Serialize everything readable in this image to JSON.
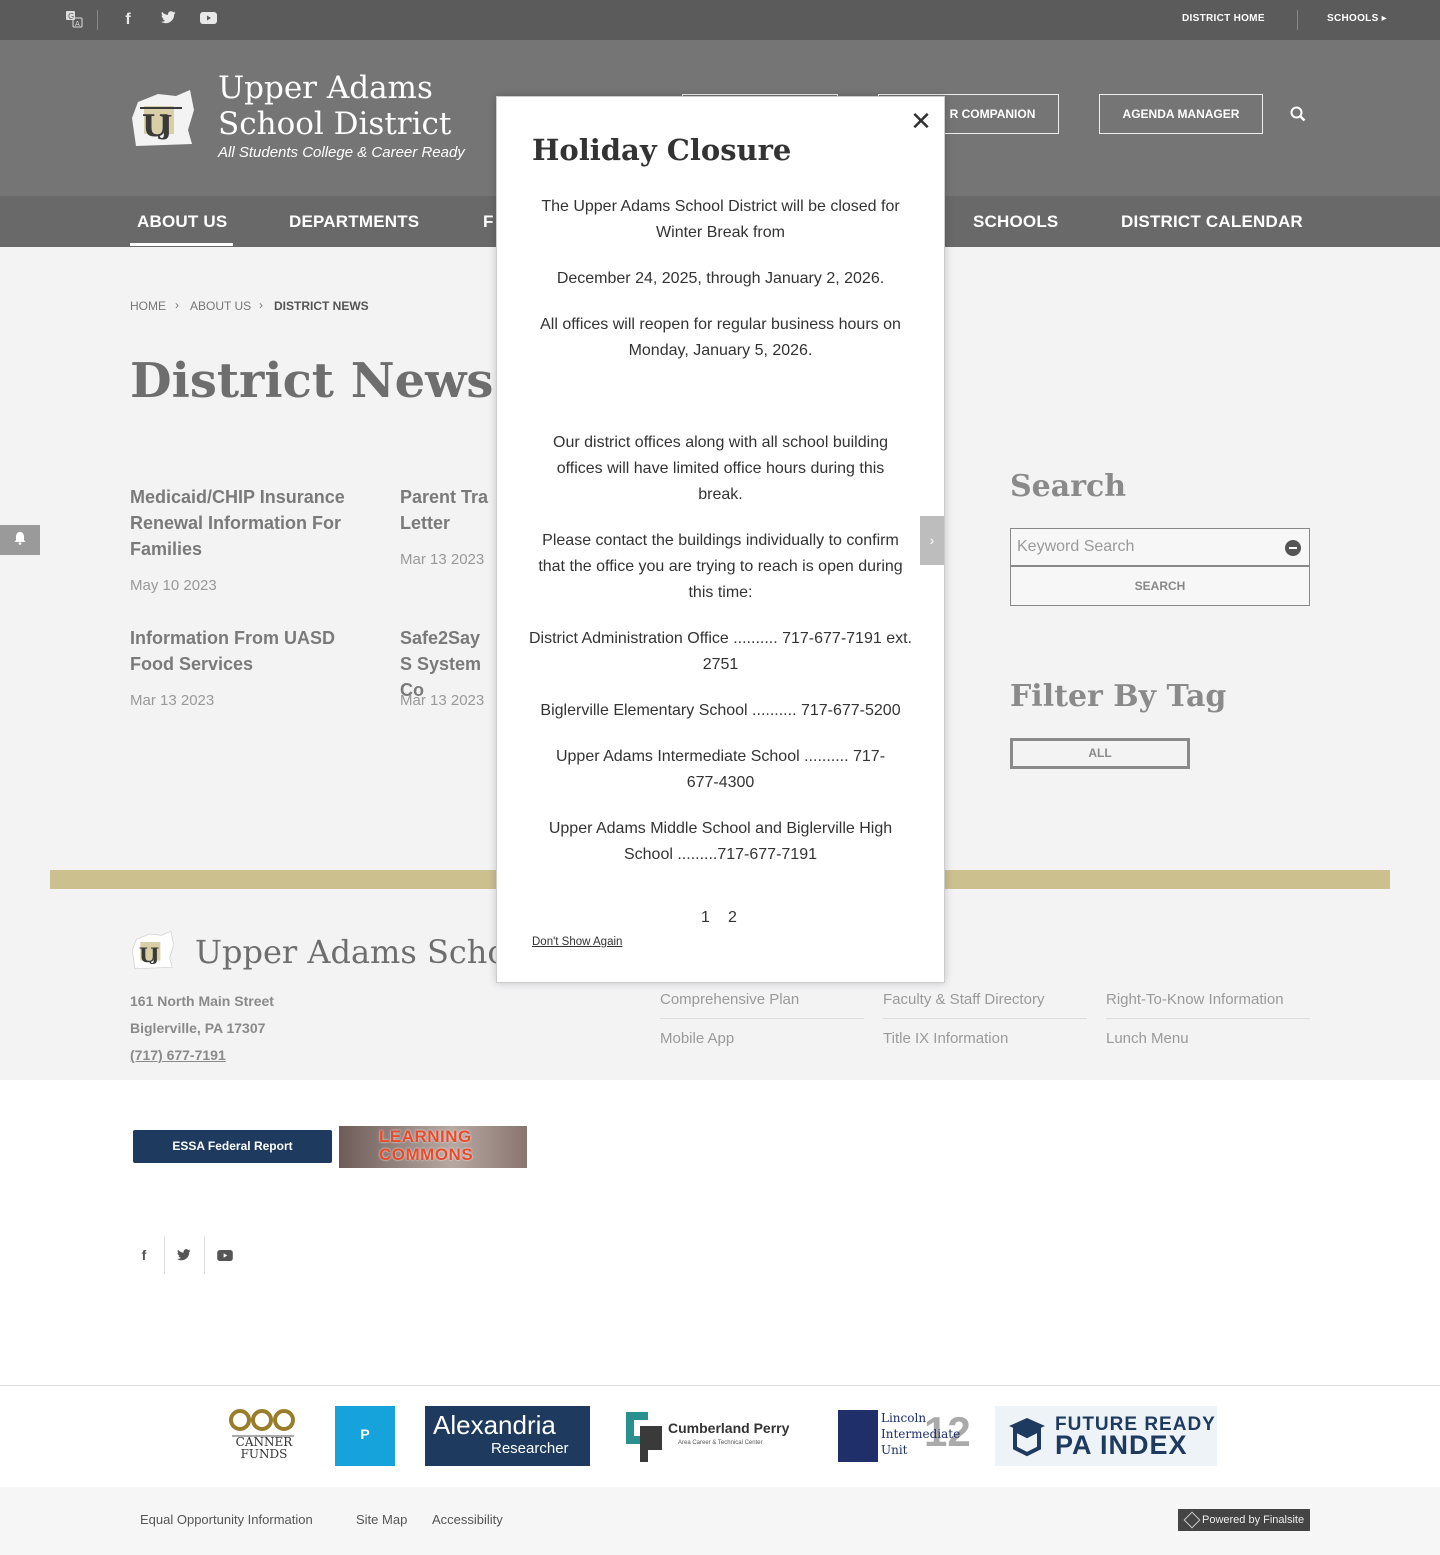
{
  "topbar": {
    "translate_icon": "translate-icon",
    "social": [
      "facebook-icon",
      "twitter-icon",
      "youtube-icon"
    ],
    "district_home": "DISTRICT HOME",
    "schools": "SCHOOLS",
    "schools_arrow": "▸"
  },
  "header": {
    "title": "Upper Adams School District",
    "tagline": "All Students College & Career Ready",
    "companion_button": "R COMPANION",
    "agenda_button": "AGENDA MANAGER",
    "search_icon": "search-icon"
  },
  "nav": {
    "items": [
      "ABOUT US",
      "DEPARTMENTS",
      "F",
      "SCHOOLS",
      "DISTRICT CALENDAR"
    ]
  },
  "breadcrumb": {
    "home": "HOME",
    "about": "ABOUT US",
    "current": "DISTRICT NEWS",
    "sep": "›"
  },
  "page": {
    "title": "District News",
    "news": [
      {
        "title": "Medicaid/CHIP Insurance Renewal Information For Families",
        "date": "May 10 2023"
      },
      {
        "title": "Parent Tra Letter",
        "date": "Mar 13 2023"
      },
      {
        "title": "Information From UASD Food Services",
        "date": "Mar 13 2023"
      },
      {
        "title": "Safe2Say S System Co",
        "date": "Mar 13 2023"
      }
    ]
  },
  "sidebar": {
    "search_heading": "Search",
    "search_placeholder": "Keyword Search",
    "search_button": "SEARCH",
    "filter_heading": "Filter By Tag",
    "tag_all": "ALL",
    "notification_icon": "bell-icon"
  },
  "footer": {
    "title": "Upper Adams School",
    "address1": "161 North Main Street",
    "address2": "Biglerville, PA  17307",
    "phone": "(717) 677-7191",
    "quicklinks": [
      "Comprehensive Plan",
      "Faculty & Staff Directory",
      "Right-To-Know Information",
      "Mobile App",
      "Title IX Information",
      "Lunch Menu"
    ],
    "essa": "ESSA Federal Report",
    "commons_line1": "LEARNING",
    "commons_line2": "COMMONS",
    "social": [
      "facebook-icon",
      "twitter-icon",
      "youtube-icon"
    ],
    "partners": {
      "canner": "CANNER FUNDS",
      "alexandria_1": "Alexandria",
      "alexandria_2": "Researcher",
      "cumberland": "Cumberland Perry",
      "cumberland_sub": "Area Career & Technical Center",
      "lincoln": "Lincoln Intermediate Unit",
      "lincoln_num": "12",
      "future_ready_1": "FUTURE READY",
      "future_ready_2": "PA INDEX"
    },
    "bottom_links": [
      "Equal Opportunity Information",
      "Site Map",
      "Accessibility"
    ],
    "powered": "Powered by Finalsite"
  },
  "modal": {
    "title": "Holiday Closure",
    "close_glyph": "✕",
    "paragraphs": [
      "The Upper Adams School District will be closed for Winter Break from",
      "December 24, 2025, through January 2, 2026.",
      "All offices will reopen for regular business hours on Monday, January 5, 2026.",
      "Our district offices along with all school building offices will have limited office hours during this break.",
      "Please contact the buildings individually to confirm that the office you are trying to reach is open during this time:",
      "District Administration Office .......... 717-677-7191 ext. 2751",
      "Biglerville Elementary School .......... 717-677-5200",
      "Upper Adams Intermediate School .......... 717-677-4300",
      "Upper Adams Middle School and Biglerville High School .........717-677-7191"
    ],
    "pages": [
      "1",
      "2"
    ],
    "dont_show": "Don't Show Again",
    "next_glyph": "›"
  },
  "colors": {
    "topbar": "#5b5b5b",
    "header": "#757575",
    "nav": "#696969",
    "gold": "#cdc08f",
    "essa": "#1e3a5f"
  }
}
